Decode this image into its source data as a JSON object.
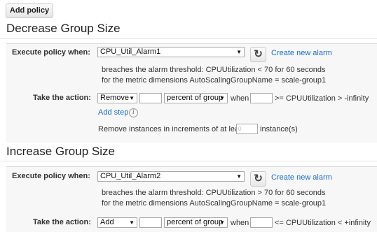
{
  "toolbar": {
    "add_policy_label": "Add policy"
  },
  "decrease": {
    "title": "Decrease Group Size",
    "execute_label": "Execute policy when:",
    "alarm_value": "CPU_Util_Alarm1",
    "create_alarm_label": "Create new alarm",
    "threshold_text": "breaches the alarm threshold: CPUUtilization < 70 for 60 seconds",
    "dimensions_text": "for the metric dimensions AutoScalingGroupName = scale-group1",
    "take_action_label": "Take the action:",
    "action_value": "Remove",
    "unit_value": "percent of group",
    "when_text": "when",
    "condition_text": ">= CPUUtilization > -infinity",
    "add_step_label": "Add step",
    "increment_prefix": "Remove instances in increments of at least",
    "increment_placeholder": "0",
    "increment_suffix": "instance(s)"
  },
  "increase": {
    "title": "Increase Group Size",
    "execute_label": "Execute policy when:",
    "alarm_value": "CPU_Util_Alarm2",
    "create_alarm_label": "Create new alarm",
    "threshold_text": "breaches the alarm threshold: CPUUtilization > 70 for 60 seconds",
    "dimensions_text": "for the metric dimensions AutoScalingGroupName = scale-group1",
    "take_action_label": "Take the action:",
    "action_value": "Add",
    "unit_value": "percent of group",
    "when_text": "when",
    "condition_text": "<= CPUUtilization < +infinity"
  },
  "icons": {
    "refresh": "refresh-icon",
    "info": "info-icon",
    "dropdown": "chevron-down-icon"
  }
}
